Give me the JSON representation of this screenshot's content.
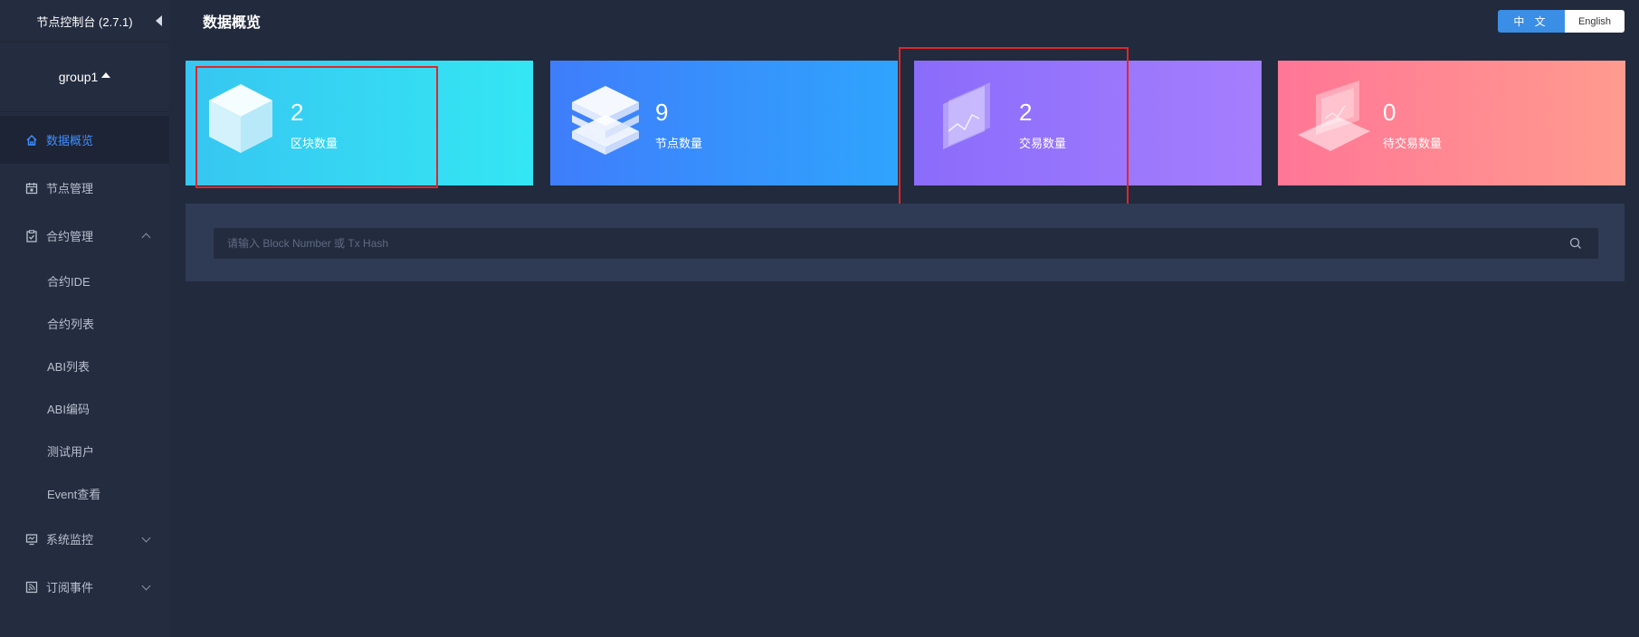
{
  "app": {
    "title": "节点控制台 (2.7.1)",
    "group": "group1"
  },
  "sidebar": {
    "items": [
      {
        "label": "数据概览",
        "icon": "home-icon",
        "active": true
      },
      {
        "label": "节点管理",
        "icon": "calendar-icon"
      },
      {
        "label": "合约管理",
        "icon": "clipboard-icon",
        "expanded": true,
        "children": [
          "合约IDE",
          "合约列表",
          "ABI列表",
          "ABI编码",
          "测试用户",
          "Event查看"
        ]
      },
      {
        "label": "系统监控",
        "icon": "monitor-icon"
      },
      {
        "label": "订阅事件",
        "icon": "rss-icon"
      }
    ]
  },
  "header": {
    "title": "数据概览",
    "lang_zh": "中 文",
    "lang_en": "English"
  },
  "cards": [
    {
      "value": "2",
      "label": "区块数量",
      "icon": "cube-icon"
    },
    {
      "value": "9",
      "label": "节点数量",
      "icon": "server-icon"
    },
    {
      "value": "2",
      "label": "交易数量",
      "icon": "chart-panel-icon"
    },
    {
      "value": "0",
      "label": "待交易数量",
      "icon": "laptop-icon"
    }
  ],
  "search": {
    "placeholder": "请输入 Block Number 或 Tx Hash",
    "value": ""
  },
  "colors": {
    "accent": "#3d8eff",
    "background": "#222a3d",
    "sidebar": "#242c40",
    "highlight": "#e0262a"
  }
}
